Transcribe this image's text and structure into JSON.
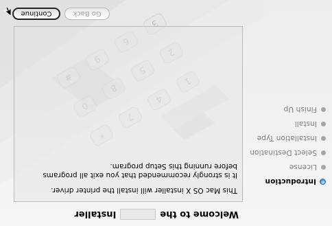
{
  "window": {
    "title_prefix": "Welcome to the",
    "title_suffix": "Installer"
  },
  "steps": [
    {
      "label": "Introduction",
      "active": true
    },
    {
      "label": "License",
      "active": false
    },
    {
      "label": "Select Destination",
      "active": false
    },
    {
      "label": "Installation Type",
      "active": false
    },
    {
      "label": "Install",
      "active": false
    },
    {
      "label": "Finish Up",
      "active": false
    }
  ],
  "content": {
    "paragraph1": "This Mac OS X installer will install the printer driver.",
    "paragraph2_line1": "It is strongly recommended that you exit all programs",
    "paragraph2_line2": "before running this Setup program."
  },
  "buttons": {
    "go_back": "Go Back",
    "continue": "Continue"
  },
  "display": {
    "orientation": "rotated 180 degrees",
    "backdrop_icon": "telephone-keypad-icon",
    "keypad_keys": [
      "1",
      "2",
      "3",
      "4",
      "5",
      "6",
      "7",
      "8",
      "9",
      "*",
      "0",
      "#"
    ],
    "active_step_color": "#2a5fae"
  }
}
